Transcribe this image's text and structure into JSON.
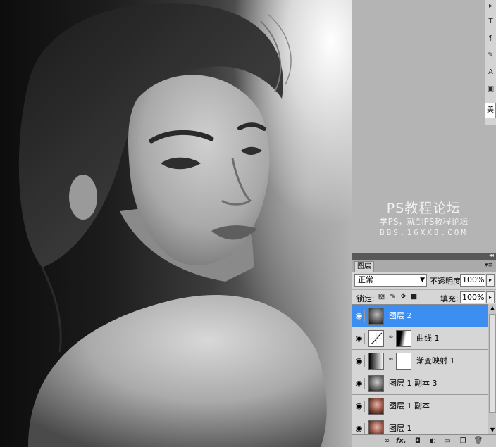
{
  "watermark": {
    "title": "PS教程论坛",
    "subtitle": "学PS，就到PS教程论坛",
    "url": "BBS.16XX8.COM"
  },
  "tool_strip": {
    "buttons": [
      "▸",
      "T",
      "¶",
      "✎",
      "A",
      "▣"
    ],
    "field_text": "美"
  },
  "layers_panel": {
    "tab_label": "图层",
    "menu_icon": "▾≡",
    "collapse_icon": "◂◂",
    "blend_mode": "正常",
    "opacity_label": "不透明度:",
    "opacity_value": "100%",
    "lock_label": "锁定:",
    "fill_label": "填充:",
    "fill_value": "100%",
    "layers": [
      {
        "name": "图层 2",
        "selected": true
      },
      {
        "name": "曲线 1",
        "selected": false
      },
      {
        "name": "渐变映射 1",
        "selected": false
      },
      {
        "name": "图层 1 副本 3",
        "selected": false
      },
      {
        "name": "图层 1 副本",
        "selected": false
      },
      {
        "name": "图层 1",
        "selected": false
      }
    ],
    "footer_icons": [
      "link-layers-icon",
      "fx-icon",
      "add-mask-icon",
      "adjustment-layer-icon",
      "group-folder-icon",
      "new-layer-icon",
      "trash-icon"
    ]
  },
  "colors": {
    "selected_row": "#3c8ef0",
    "panel_bg": "#d6d6d6",
    "workspace_gray": "#b4b4b4"
  }
}
